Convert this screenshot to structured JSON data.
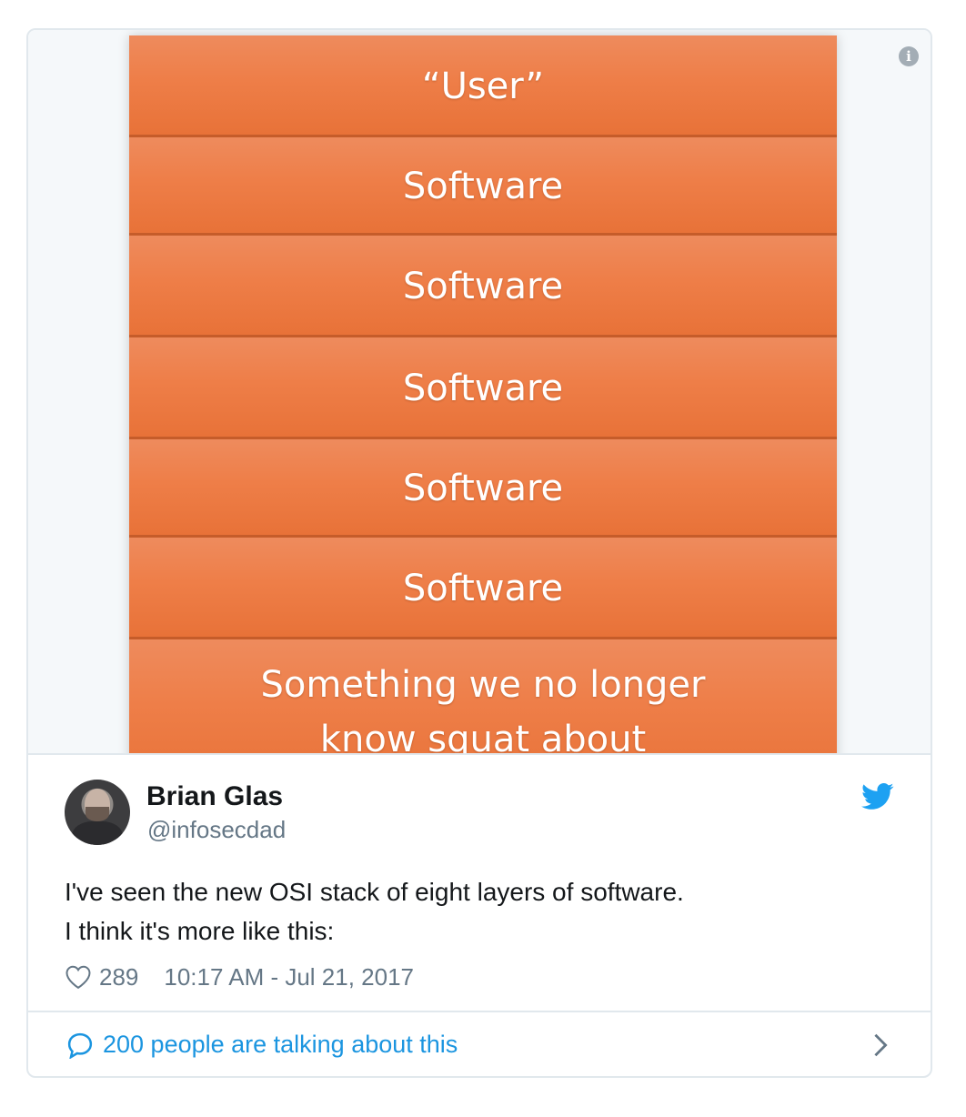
{
  "media": {
    "info_icon": "info-icon",
    "layers": [
      {
        "label": "“User”"
      },
      {
        "label": "Software"
      },
      {
        "label": "Software"
      },
      {
        "label": "Software"
      },
      {
        "label": "Software"
      },
      {
        "label": "Software"
      },
      {
        "label": "Something we no longer know squat about"
      }
    ],
    "colors": {
      "layer_fill": "#ee7e48",
      "layer_border": "#c55c2a",
      "background": "#f5f8fa"
    }
  },
  "tweet": {
    "author": {
      "name": "Brian Glas",
      "handle": "@infosecdad"
    },
    "brand_icon": "twitter-bird-icon",
    "text_lines": [
      "I've seen the new OSI stack of eight layers of software.",
      "I think it's more like this:"
    ],
    "likes": "289",
    "timestamp": "10:17 AM - Jul 21, 2017",
    "conversation": "200 people are talking about this",
    "colors": {
      "brand": "#1da1f2",
      "link": "#1b95e0",
      "muted": "#657786",
      "text": "#14171a"
    }
  }
}
